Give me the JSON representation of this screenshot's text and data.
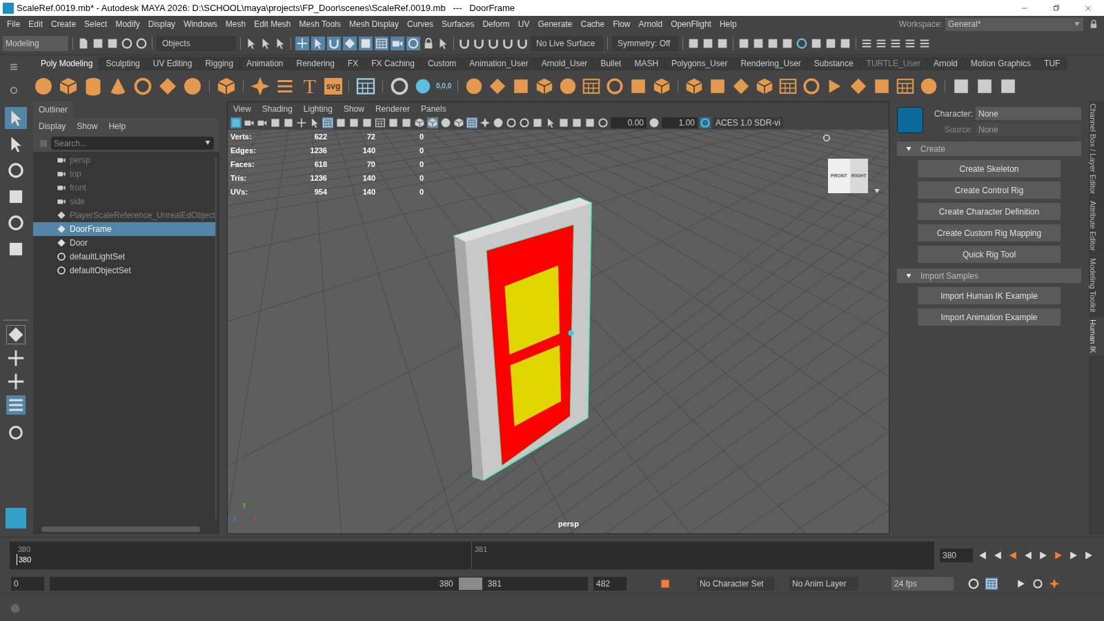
{
  "window": {
    "title": "ScaleRef.0019.mb* - Autodesk MAYA 2026: D:\\SCHOOL\\maya\\projects\\FP_Door\\scenes\\ScaleRef.0019.mb   ---   DoorFrame"
  },
  "menu": [
    "File",
    "Edit",
    "Create",
    "Select",
    "Modify",
    "Display",
    "Windows",
    "Mesh",
    "Edit Mesh",
    "Mesh Tools",
    "Mesh Display",
    "Curves",
    "Surfaces",
    "Deform",
    "UV",
    "Generate",
    "Cache",
    "Flow",
    "Arnold",
    "OpenFlight",
    "Help"
  ],
  "workspace": {
    "label": "Workspace:",
    "value": "General*"
  },
  "status_line": {
    "menu_set": "Modeling",
    "selection_mode": "Objects",
    "live_surface": "No Live Surface",
    "symmetry": "Symmetry: Off",
    "snap_toggles": [
      {
        "selected": true
      },
      {
        "selected": true
      },
      {
        "selected": true
      },
      {
        "selected": true
      },
      {
        "selected": true
      },
      {
        "selected": true
      },
      {
        "selected": true
      },
      {
        "selected": true
      }
    ]
  },
  "shelf_tabs": [
    {
      "label": "Poly Modeling",
      "selected": true,
      "dimmed": false
    },
    {
      "label": "Sculpting",
      "selected": false,
      "dimmed": false
    },
    {
      "label": "UV Editing",
      "selected": false,
      "dimmed": false
    },
    {
      "label": "Rigging",
      "selected": false,
      "dimmed": false
    },
    {
      "label": "Animation",
      "selected": false,
      "dimmed": false
    },
    {
      "label": "Rendering",
      "selected": false,
      "dimmed": false
    },
    {
      "label": "FX",
      "selected": false,
      "dimmed": false
    },
    {
      "label": "FX Caching",
      "selected": false,
      "dimmed": false
    },
    {
      "label": "Custom",
      "selected": false,
      "dimmed": false
    },
    {
      "label": "Animation_User",
      "selected": false,
      "dimmed": false
    },
    {
      "label": "Arnold_User",
      "selected": false,
      "dimmed": false
    },
    {
      "label": "Bullet",
      "selected": false,
      "dimmed": false
    },
    {
      "label": "MASH",
      "selected": false,
      "dimmed": false
    },
    {
      "label": "Polygons_User",
      "selected": false,
      "dimmed": false
    },
    {
      "label": "Rendering_User",
      "selected": false,
      "dimmed": false
    },
    {
      "label": "Substance",
      "selected": false,
      "dimmed": false
    },
    {
      "label": "TURTLE_User",
      "selected": false,
      "dimmed": true
    },
    {
      "label": "Arnold",
      "selected": false,
      "dimmed": false
    },
    {
      "label": "Motion Graphics",
      "selected": false,
      "dimmed": false
    },
    {
      "label": "TUF",
      "selected": false,
      "dimmed": false
    }
  ],
  "shelf_icon_text": {
    "text_tool": "T",
    "svg": "svg",
    "origin": "0,0,0"
  },
  "toolbox": [
    {
      "selected": true
    },
    {
      "selected": false
    },
    {
      "selected": false
    },
    {
      "selected": false
    },
    {
      "selected": false
    },
    {
      "selected": false
    }
  ],
  "outliner": {
    "title": "Outliner",
    "menu": [
      "Display",
      "Show",
      "Help"
    ],
    "search": {
      "placeholder": "Search..."
    },
    "items": [
      {
        "kind": "camera",
        "label": "persp",
        "dimmed": true,
        "selected": false
      },
      {
        "kind": "camera",
        "label": "top",
        "dimmed": true,
        "selected": false
      },
      {
        "kind": "camera",
        "label": "front",
        "dimmed": true,
        "selected": false
      },
      {
        "kind": "camera",
        "label": "side",
        "dimmed": true,
        "selected": false
      },
      {
        "kind": "transform",
        "label": "PlayerScaleReference_UnrealEdObject",
        "dimmed": true,
        "selected": false
      },
      {
        "kind": "transform",
        "label": "DoorFrame",
        "dimmed": false,
        "selected": true
      },
      {
        "kind": "transform",
        "label": "Door",
        "dimmed": false,
        "selected": false
      },
      {
        "kind": "set",
        "label": "defaultLightSet",
        "dimmed": false,
        "selected": false
      },
      {
        "kind": "set",
        "label": "defaultObjectSet",
        "dimmed": false,
        "selected": false
      }
    ]
  },
  "viewport": {
    "menu": [
      "View",
      "Shading",
      "Lighting",
      "Show",
      "Renderer",
      "Panels"
    ],
    "exposure": "0.00",
    "gamma": "1.00",
    "color_space": "ACES 1.0 SDR-vi",
    "hud": [
      {
        "label": "Verts:",
        "values": [
          "622",
          "72",
          "0"
        ]
      },
      {
        "label": "Edges:",
        "values": [
          "1236",
          "140",
          "0"
        ]
      },
      {
        "label": "Faces:",
        "values": [
          "618",
          "70",
          "0"
        ]
      },
      {
        "label": "Tris:",
        "values": [
          "1236",
          "140",
          "0"
        ]
      },
      {
        "label": "UVs:",
        "values": [
          "954",
          "140",
          "0"
        ]
      }
    ],
    "view_cube": {
      "front": "FRONT",
      "right": "RIGHT"
    },
    "camera": "persp",
    "axis_labels": [
      "y",
      "z",
      "x"
    ]
  },
  "human_ik": {
    "character": {
      "label": "Character:",
      "value": "None"
    },
    "source": {
      "label": "Source:",
      "value": "None",
      "disabled": true
    },
    "sections": [
      {
        "title": "Create",
        "expanded": true,
        "buttons": [
          "Create Skeleton",
          "Create Control Rig",
          "Create Character Definition",
          "Create Custom Rig Mapping",
          "Quick Rig Tool"
        ]
      },
      {
        "title": "Import Samples",
        "expanded": true,
        "buttons": [
          "Import Human IK Example",
          "Import Animation Example"
        ]
      }
    ]
  },
  "side_tabs": [
    {
      "label": "Channel Box / Layer Editor",
      "selected": false
    },
    {
      "label": "Attribute Editor",
      "selected": false
    },
    {
      "label": "Modeling Toolkit",
      "selected": false
    },
    {
      "label": "Human IK",
      "selected": true
    }
  ],
  "time_slider": {
    "ticks": [
      "380",
      "381"
    ],
    "current": "380",
    "current_frame": "380"
  },
  "range_slider": {
    "level": 0.76,
    "start": "0",
    "range_start": "380",
    "range_end": "381",
    "end": "482",
    "character_set": "No Character Set",
    "anim_layer": "No Anim Layer",
    "fps": "24 fps"
  }
}
